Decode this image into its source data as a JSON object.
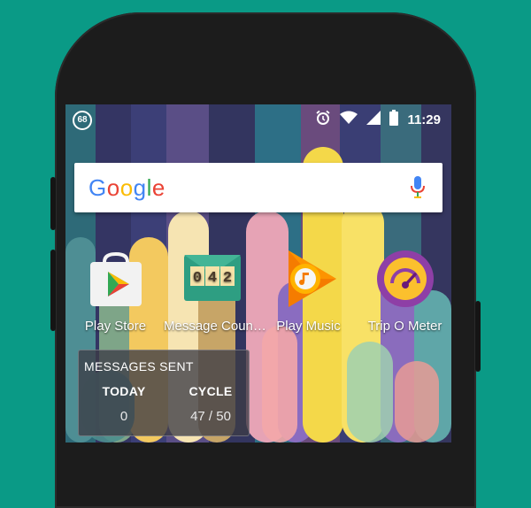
{
  "status_bar": {
    "notification_count": "68",
    "time": "11:29",
    "icons": [
      "alarm-icon",
      "wifi-icon",
      "signal-icon",
      "battery-icon"
    ]
  },
  "search": {
    "logo_text": "Google",
    "logo_colors": [
      "#4285F4",
      "#EA4335",
      "#FBBC05",
      "#4285F4",
      "#34A853",
      "#EA4335"
    ],
    "mic_icon": "mic-icon"
  },
  "apps": [
    {
      "label": "Play Store",
      "icon": "play-store-icon"
    },
    {
      "label": "Message Coun…",
      "icon": "message-counter-icon",
      "counter_digits": [
        "0",
        "4",
        "2"
      ]
    },
    {
      "label": "Play Music",
      "icon": "play-music-icon"
    },
    {
      "label": "Trip O Meter",
      "icon": "trip-o-meter-icon"
    }
  ],
  "widget": {
    "title": "MESSAGES SENT",
    "today_label": "TODAY",
    "today_value": "0",
    "cycle_label": "CYCLE",
    "cycle_value": "47 / 50"
  },
  "colors": {
    "background": "#0a9a86",
    "phone_body": "#1c1c1c"
  }
}
